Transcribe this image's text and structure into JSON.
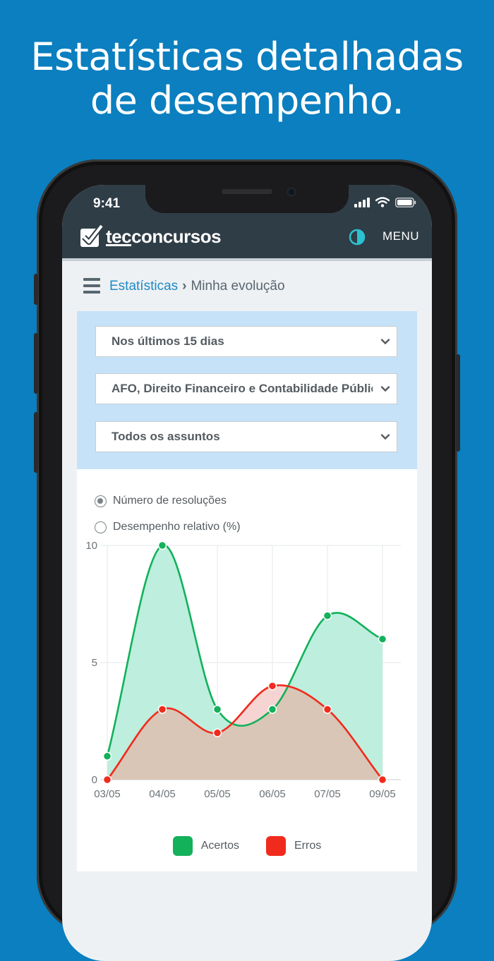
{
  "headline": {
    "line1": "Estatísticas detalhadas",
    "line2": "de desempenho."
  },
  "status_bar": {
    "time": "9:41"
  },
  "app": {
    "brand_prefix": "tec",
    "brand_suffix": "concursos",
    "menu_label": "MENU"
  },
  "breadcrumb": {
    "section": "Estatísticas",
    "separator": "›",
    "current": "Minha evolução"
  },
  "filters": {
    "period": "Nos últimos 15 dias",
    "subject": "AFO, Direito Financeiro e Contabilidade Pública",
    "topic": "Todos os assuntos"
  },
  "view_options": [
    {
      "label": "Número de resoluções",
      "selected": true
    },
    {
      "label": "Desempenho relativo (%)",
      "selected": false
    }
  ],
  "colors": {
    "acertos": "#12b15a",
    "erros": "#f02b1d",
    "acertos_fill": "#bdeede",
    "erros_fill": "#f3c5c3",
    "overlap_fill": "#d9c6b6"
  },
  "chart_data": {
    "type": "area",
    "x": [
      "03/05",
      "04/05",
      "05/05",
      "06/05",
      "07/05",
      "09/05"
    ],
    "ylim": [
      0,
      10
    ],
    "yticks": [
      0,
      5,
      10
    ],
    "grid": true,
    "legend_placement": "bottom",
    "series": [
      {
        "name": "Acertos",
        "values": [
          1,
          10,
          3,
          3,
          7,
          6
        ]
      },
      {
        "name": "Erros",
        "values": [
          0,
          3,
          2,
          4,
          3,
          0
        ]
      }
    ]
  }
}
